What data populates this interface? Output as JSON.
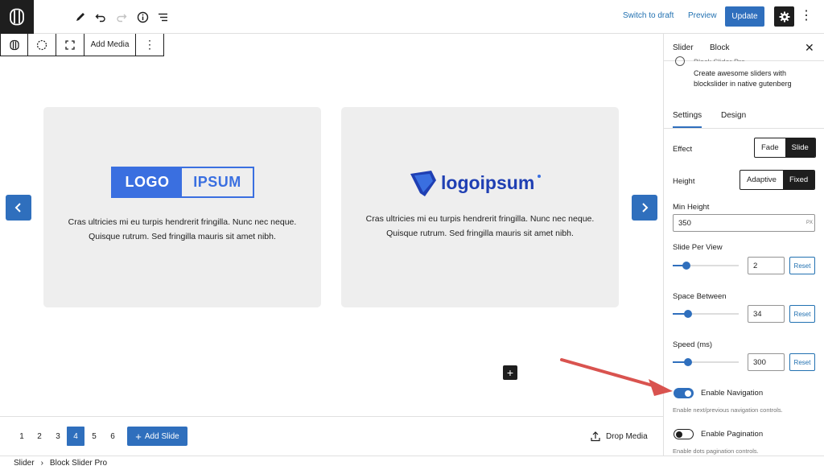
{
  "topbar": {
    "switch_to_draft": "Switch to draft",
    "preview": "Preview",
    "update": "Update"
  },
  "block_toolbar": {
    "add_media": "Add Media"
  },
  "slides": [
    {
      "logo": "LOGO IPSUM",
      "logo_part1": "LOGO",
      "logo_part2": "IPSUM",
      "line1": "Cras ultricies mi eu turpis hendrerit fringilla. Nunc nec neque.",
      "line2": "Quisque rutrum. Sed fringilla mauris sit amet nibh."
    },
    {
      "logo": "logoipsum",
      "line1": "Cras ultricies mi eu turpis hendrerit fringilla. Nunc nec neque.",
      "line2": "Quisque rutrum. Sed fringilla mauris sit amet nibh."
    }
  ],
  "pager": {
    "pages": [
      "1",
      "2",
      "3",
      "4",
      "5",
      "6"
    ],
    "active_page": "4",
    "add_slide": "Add Slide",
    "drop_media": "Drop Media"
  },
  "breadcrumb": {
    "items": [
      "Slider",
      "Block Slider Pro"
    ],
    "separator": "›"
  },
  "sidebar": {
    "tabs": [
      "Slider",
      "Block"
    ],
    "plugin_desc": "Create awesome sliders with blockslider in native gutenberg",
    "plugin_title_partial": "Block Slider Pro",
    "subtabs": [
      "Settings",
      "Design"
    ],
    "effect": {
      "label": "Effect",
      "options": [
        "Fade",
        "Slide"
      ],
      "selected": "Slide"
    },
    "height": {
      "label": "Height",
      "options": [
        "Adaptive",
        "Fixed"
      ],
      "selected": "Fixed"
    },
    "min_height": {
      "label": "Min Height",
      "value": "350",
      "unit": "PX"
    },
    "slide_per_view": {
      "label": "Slide Per View",
      "value": "2",
      "reset": "Reset",
      "fraction": 0.2
    },
    "space_between": {
      "label": "Space Between",
      "value": "34",
      "reset": "Reset",
      "fraction": 0.22
    },
    "speed": {
      "label": "Speed (ms)",
      "value": "300",
      "reset": "Reset",
      "fraction": 0.22
    },
    "enable_navigation": {
      "label": "Enable Navigation",
      "help": "Enable next/previous navigation controls.",
      "on": true
    },
    "enable_pagination": {
      "label": "Enable Pagination",
      "help": "Enable dots pagination controls.",
      "on": false
    }
  },
  "colors": {
    "accent": "#2f6fbd",
    "annotation_arrow": "#d9534f"
  }
}
